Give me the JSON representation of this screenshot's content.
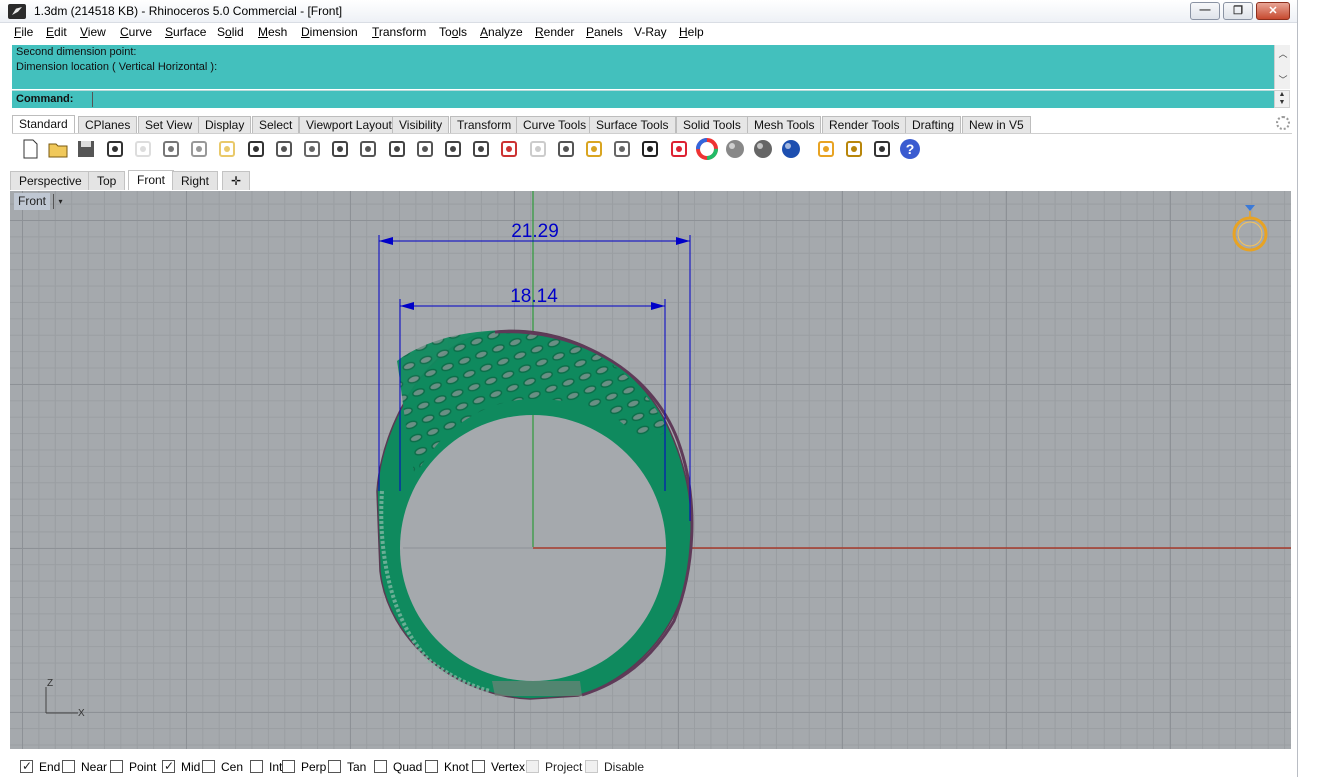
{
  "window": {
    "title": "1.3dm (214518 KB) - Rhinoceros 5.0 Commercial - [Front]",
    "min_glyph": "—",
    "max_glyph": "❐",
    "close_glyph": "✕"
  },
  "menu": [
    {
      "acc": "F",
      "rest": "ile"
    },
    {
      "acc": "E",
      "rest": "dit"
    },
    {
      "acc": "V",
      "rest": "iew"
    },
    {
      "acc": "C",
      "rest": "urve"
    },
    {
      "acc": "S",
      "rest": "urface"
    },
    {
      "pre": "S",
      "acc": "o",
      "rest": "lid"
    },
    {
      "acc": "M",
      "rest": "esh"
    },
    {
      "acc": "D",
      "rest": "imension"
    },
    {
      "acc": "T",
      "rest": "ransform"
    },
    {
      "pre": "To",
      "acc": "o",
      "rest": "ls"
    },
    {
      "acc": "A",
      "rest": "nalyze"
    },
    {
      "acc": "R",
      "rest": "ender"
    },
    {
      "acc": "P",
      "rest": "anels"
    },
    {
      "pre": "V-Ray",
      "acc": "",
      "rest": ""
    },
    {
      "acc": "H",
      "rest": "elp"
    }
  ],
  "command": {
    "history": [
      "Second dimension point:",
      "Dimension location ( Vertical  Horizontal ):"
    ],
    "prompt_label": "Command:",
    "input_value": ""
  },
  "toolbar_tabs": [
    "Standard",
    "CPlanes",
    "Set View",
    "Display",
    "Select",
    "Viewport Layout",
    "Visibility",
    "Transform",
    "Curve Tools",
    "Surface Tools",
    "Solid Tools",
    "Mesh Tools",
    "Render Tools",
    "Drafting",
    "New in V5"
  ],
  "active_toolbar_tab": "Standard",
  "tools": [
    "new-file",
    "open-file",
    "save-file",
    "print",
    "import",
    "cut",
    "copy",
    "paste",
    "undo",
    "pan",
    "rotate-view",
    "zoom-dynamic",
    "zoom-window",
    "zoom-extents",
    "zoom-selected",
    "undo-view",
    "four-viewports",
    "car-render",
    "ghosted",
    "cplane",
    "points-on",
    "light",
    "lock",
    "layer",
    "color-wheel",
    "shaded",
    "rendered",
    "material-ball",
    "cursor-options",
    "settings",
    "dimension",
    "help"
  ],
  "viewport_tabs": [
    "Perspective",
    "Top",
    "Front",
    "Right"
  ],
  "active_viewport": "Front",
  "add_viewport_glyph": "✛",
  "viewport": {
    "label": "Front",
    "dropdown_glyph": "▾",
    "dimensions": [
      {
        "value": "21.29"
      },
      {
        "value": "18.14"
      }
    ],
    "axis_labels": {
      "z": "Z",
      "x": "X"
    },
    "colors": {
      "background": "#a5a9ad",
      "dimension": "#0000c8",
      "ring": "#0f8a5e",
      "x_axis": "#a63a2c",
      "y_axis": "#2e9b3a"
    }
  },
  "osnaps": [
    {
      "label": "End",
      "checked": true,
      "disabled": false
    },
    {
      "label": "Near",
      "checked": false,
      "disabled": false
    },
    {
      "label": "Point",
      "checked": false,
      "disabled": false
    },
    {
      "label": "Mid",
      "checked": true,
      "disabled": false
    },
    {
      "label": "Cen",
      "checked": false,
      "disabled": false
    },
    {
      "label": "Int",
      "checked": false,
      "disabled": false
    },
    {
      "label": "Perp",
      "checked": false,
      "disabled": false
    },
    {
      "label": "Tan",
      "checked": false,
      "disabled": false
    },
    {
      "label": "Quad",
      "checked": false,
      "disabled": false
    },
    {
      "label": "Knot",
      "checked": false,
      "disabled": false
    },
    {
      "label": "Vertex",
      "checked": false,
      "disabled": false
    },
    {
      "label": "Project",
      "checked": false,
      "disabled": true
    },
    {
      "label": "Disable",
      "checked": false,
      "disabled": true
    }
  ]
}
